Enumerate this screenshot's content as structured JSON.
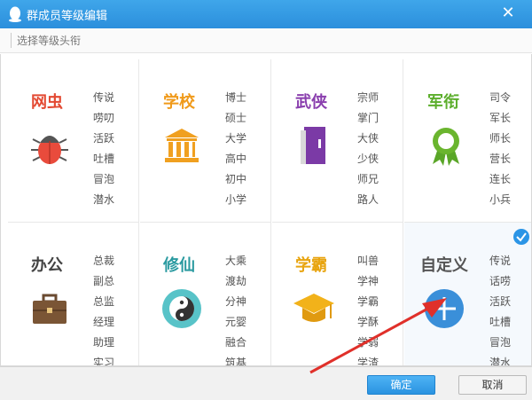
{
  "window": {
    "title": "群成员等级编辑",
    "close_glyph": "✕"
  },
  "subheader": {
    "label": "选择等级头衔"
  },
  "categories": [
    {
      "name": "网虫",
      "color": "#e34a33",
      "icon": "bug-icon",
      "levels": [
        "传说",
        "唠叨",
        "活跃",
        "吐槽",
        "冒泡",
        "潜水"
      ]
    },
    {
      "name": "学校",
      "color": "#f09a1a",
      "icon": "school-building-icon",
      "levels": [
        "博士",
        "硕士",
        "大学",
        "高中",
        "初中",
        "小学"
      ]
    },
    {
      "name": "武侠",
      "color": "#8a3fae",
      "icon": "book-icon",
      "levels": [
        "宗师",
        "掌门",
        "大侠",
        "少侠",
        "师兄",
        "路人"
      ]
    },
    {
      "name": "军衔",
      "color": "#5cae2c",
      "icon": "medal-icon",
      "levels": [
        "司令",
        "军长",
        "师长",
        "营长",
        "连长",
        "小兵"
      ]
    },
    {
      "name": "办公",
      "color": "#444444",
      "icon": "briefcase-icon",
      "levels": [
        "总裁",
        "副总",
        "总监",
        "经理",
        "助理",
        "实习"
      ]
    },
    {
      "name": "修仙",
      "color": "#2a9aa0",
      "icon": "yin-yang-icon",
      "levels": [
        "大乘",
        "渡劫",
        "分神",
        "元婴",
        "融合",
        "筑基"
      ]
    },
    {
      "name": "学霸",
      "color": "#e8a40f",
      "icon": "graduation-cap-icon",
      "levels": [
        "叫兽",
        "学神",
        "学霸",
        "学酥",
        "学弱",
        "学渣"
      ]
    },
    {
      "name": "自定义",
      "color": "#555555",
      "icon": "add-circle-icon",
      "selected": true,
      "levels": [
        "传说",
        "话唠",
        "活跃",
        "吐槽",
        "冒泡",
        "潜水"
      ]
    }
  ],
  "footer": {
    "confirm_label": "确定",
    "cancel_label": "取消"
  },
  "colors": {
    "titlebar": "#2b8fdc",
    "check": "#2b95e6",
    "arrow": "#e0302a"
  }
}
